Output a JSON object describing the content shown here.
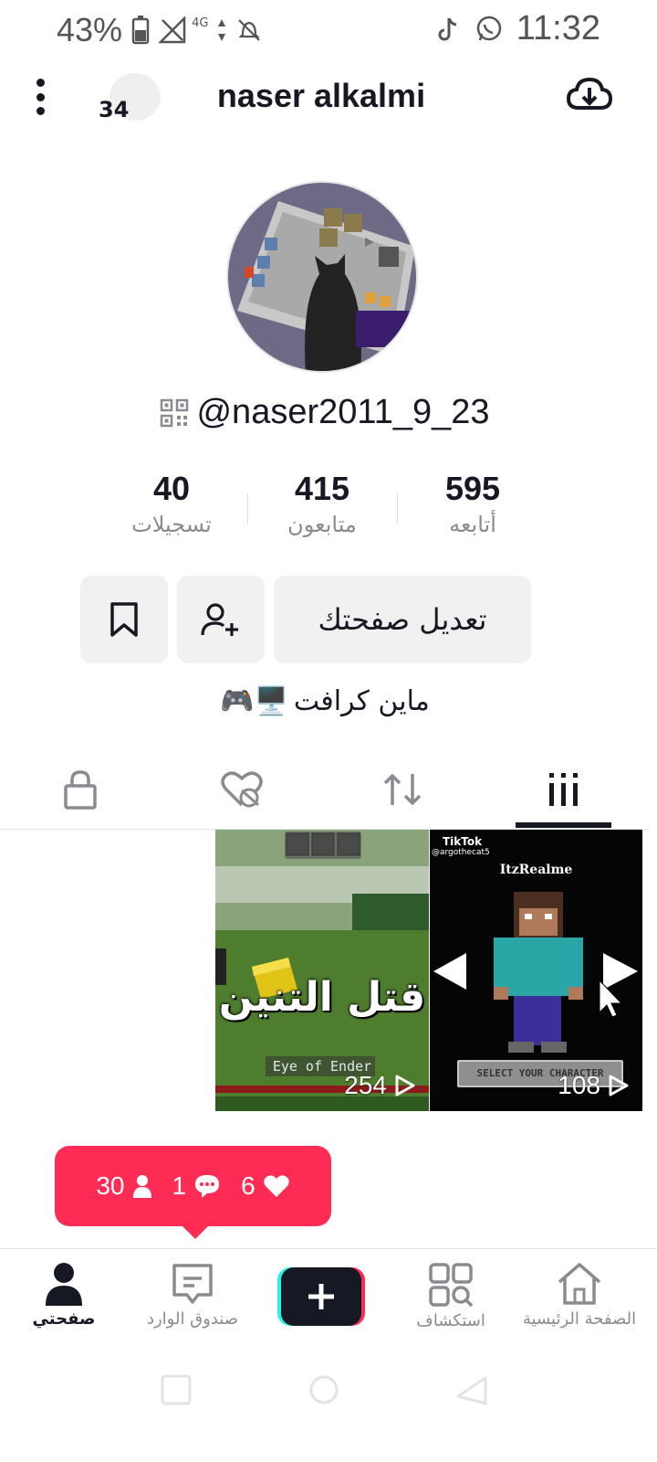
{
  "status_bar": {
    "battery": "43%",
    "network": "4G",
    "time": "11:32"
  },
  "header": {
    "notification_count": "34",
    "name": "naser alkalmi"
  },
  "profile": {
    "username": "@naser2011_9_23",
    "bio_text": "ماين كرافت",
    "bio_emoji": "🎮🖥️"
  },
  "stats": {
    "following": {
      "value": "40",
      "label": "تسجيلات"
    },
    "followers": {
      "value": "415",
      "label": "متابعون"
    },
    "likes": {
      "value": "595",
      "label": "أتابعه"
    }
  },
  "actions": {
    "edit_label": "تعديل صفحتك"
  },
  "videos": [
    {
      "title": "قتل التنين",
      "caption": "Eye of Ender",
      "views": "254"
    },
    {
      "title": "ItzRealme",
      "caption": "SELECT YOUR CHARACTER",
      "brand": "TikTok",
      "handle": "@argothecat5",
      "views": "108"
    }
  ],
  "notification_bubble": {
    "followers": "30",
    "comments": "1",
    "likes": "6"
  },
  "bottom_nav": {
    "home": "الصفحة الرئيسية",
    "discover": "استكشاف",
    "inbox": "صندوق الوارد",
    "profile": "صفحتي"
  },
  "colors": {
    "accent": "#fe2c55",
    "text": "#161823",
    "muted": "#8a8b91"
  }
}
